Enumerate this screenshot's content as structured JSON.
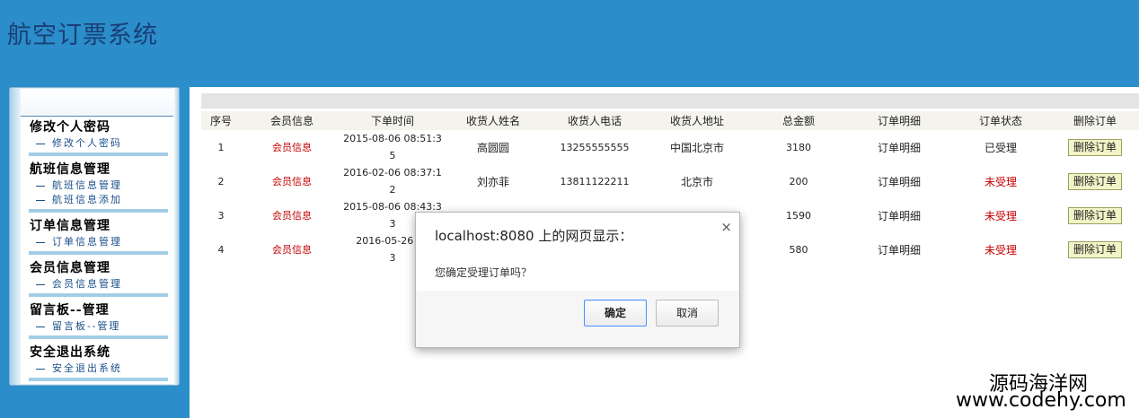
{
  "app": {
    "title": "航空订票系统"
  },
  "sidebar": {
    "groups": [
      {
        "title": "修改个人密码",
        "items": [
          "修改个人密码"
        ]
      },
      {
        "title": "航班信息管理",
        "items": [
          "航班信息管理",
          "航班信息添加"
        ]
      },
      {
        "title": "订单信息管理",
        "items": [
          "订单信息管理"
        ]
      },
      {
        "title": "会员信息管理",
        "items": [
          "会员信息管理"
        ]
      },
      {
        "title": "留言板--管理",
        "items": [
          "留言板--管理"
        ]
      },
      {
        "title": "安全退出系统",
        "items": [
          "安全退出系统"
        ]
      }
    ]
  },
  "table": {
    "headers": [
      "序号",
      "会员信息",
      "下单时间",
      "收货人姓名",
      "收货人电话",
      "收货人地址",
      "总金额",
      "订单明细",
      "订单状态",
      "删除订单"
    ],
    "rows": [
      {
        "no": "1",
        "member": "会员信息",
        "time_a": "2015-08-06 08:51:3",
        "time_b": "5",
        "name": "高圆圆",
        "phone": "13255555555",
        "address": "中国北京市",
        "amount": "3180",
        "detail": "订单明细",
        "status": "已受理",
        "delete": "删除订单"
      },
      {
        "no": "2",
        "member": "会员信息",
        "time_a": "2016-02-06 08:37:1",
        "time_b": "2",
        "name": "刘亦菲",
        "phone": "13811122211",
        "address": "北京市",
        "amount": "200",
        "detail": "订单明细",
        "status": "未受理",
        "delete": "删除订单"
      },
      {
        "no": "3",
        "member": "会员信息",
        "time_a": "2015-08-06 08:43:3",
        "time_b": "3",
        "name": "",
        "phone": "",
        "address": "",
        "amount": "1590",
        "detail": "订单明细",
        "status": "未受理",
        "delete": "删除订单"
      },
      {
        "no": "4",
        "member": "会员信息",
        "time_a": "2016-05-26 01",
        "time_b": "3",
        "name": "",
        "phone": "",
        "address": "",
        "amount": "580",
        "detail": "订单明细",
        "status": "未受理",
        "delete": "删除订单"
      }
    ]
  },
  "dialog": {
    "title": "localhost:8080 上的网页显示：",
    "close": "×",
    "message": "您确定受理订单吗？",
    "ok": "确定",
    "cancel": "取消"
  },
  "watermark": {
    "line1": "源码海洋网",
    "line2": "www.codehy.com"
  },
  "colors": {
    "header_bg": "#2b8dc9",
    "title": "#1a3f77",
    "status_pending": "#c40000",
    "member_link": "#c40000"
  }
}
